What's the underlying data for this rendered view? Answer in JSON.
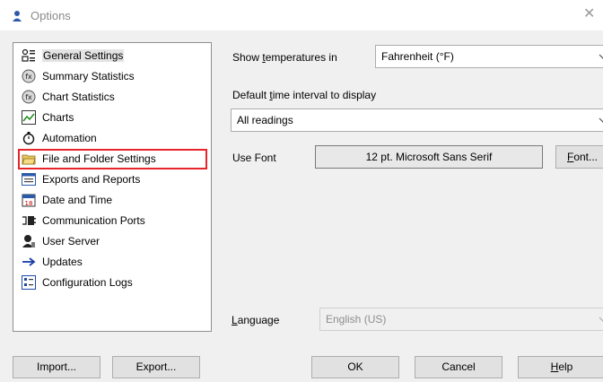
{
  "window": {
    "title": "Options",
    "close_glyph": "✕"
  },
  "sidebar": {
    "items": [
      {
        "label": "General Settings",
        "icon": "general-settings-icon"
      },
      {
        "label": "Summary Statistics",
        "icon": "summary-statistics-icon"
      },
      {
        "label": "Chart Statistics",
        "icon": "chart-statistics-icon"
      },
      {
        "label": "Charts",
        "icon": "chart-icon"
      },
      {
        "label": "Automation",
        "icon": "stopwatch-icon"
      },
      {
        "label": "File and Folder Settings",
        "icon": "folder-icon"
      },
      {
        "label": "Exports and Reports",
        "icon": "export-report-icon"
      },
      {
        "label": "Date and Time",
        "icon": "calendar-icon"
      },
      {
        "label": "Communication Ports",
        "icon": "port-plug-icon"
      },
      {
        "label": "User Server",
        "icon": "user-server-icon"
      },
      {
        "label": "Updates",
        "icon": "arrow-right-icon"
      },
      {
        "label": "Configuration Logs",
        "icon": "log-icon"
      }
    ],
    "selected_index": 0,
    "highlighted_index": 5,
    "highlight_color": "#e8242a"
  },
  "settings": {
    "temperature": {
      "label_pre": "Show ",
      "label_underlined": "t",
      "label_post": "emperatures in",
      "value": "Fahrenheit (°F)"
    },
    "interval": {
      "label_pre": "Default ",
      "label_underlined": "t",
      "label_post": "ime interval to display",
      "value": "All readings"
    },
    "font": {
      "label": "Use Font",
      "value": "12 pt. Microsoft Sans Serif",
      "button_underlined": "F",
      "button_rest": "ont..."
    },
    "language": {
      "label_underlined": "L",
      "label_rest": "anguage",
      "value": "English (US)"
    }
  },
  "buttons": {
    "import": "Import...",
    "export": "Export...",
    "ok": "OK",
    "cancel": "Cancel",
    "help_underlined": "H",
    "help_rest": "elp"
  }
}
